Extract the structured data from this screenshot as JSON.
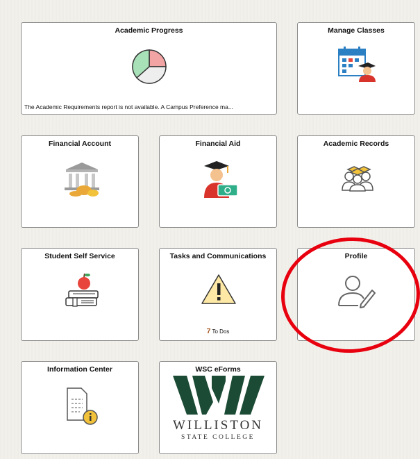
{
  "tiles": {
    "academic_progress": {
      "title": "Academic Progress",
      "note": "The Academic Requirements report is not available.  A Campus Preference ma...",
      "icon": "pie-chart-icon"
    },
    "manage_classes": {
      "title": "Manage Classes",
      "icon": "calendar-student-icon"
    },
    "financial_account": {
      "title": "Financial Account",
      "icon": "bank-money-icon"
    },
    "financial_aid": {
      "title": "Financial Aid",
      "icon": "graduate-money-icon"
    },
    "academic_records": {
      "title": "Academic Records",
      "icon": "graduates-icon"
    },
    "student_self_service": {
      "title": "Student Self Service",
      "icon": "apple-books-icon"
    },
    "tasks_and_communications": {
      "title": "Tasks and Communications",
      "icon": "warning-icon",
      "todo_count": "7",
      "todo_label": "To Dos"
    },
    "profile": {
      "title": "Profile",
      "icon": "user-edit-icon"
    },
    "information_center": {
      "title": "Information Center",
      "icon": "document-info-icon"
    },
    "wsc_eforms": {
      "title": "WSC eForms",
      "logo_name": "WILLISTON",
      "logo_sub": "STATE COLLEGE",
      "icon": "wsc-logo"
    }
  },
  "colors": {
    "annotation": "#e8000e",
    "logo_green": "#1b4b34",
    "todo_count": "#a3541c"
  }
}
